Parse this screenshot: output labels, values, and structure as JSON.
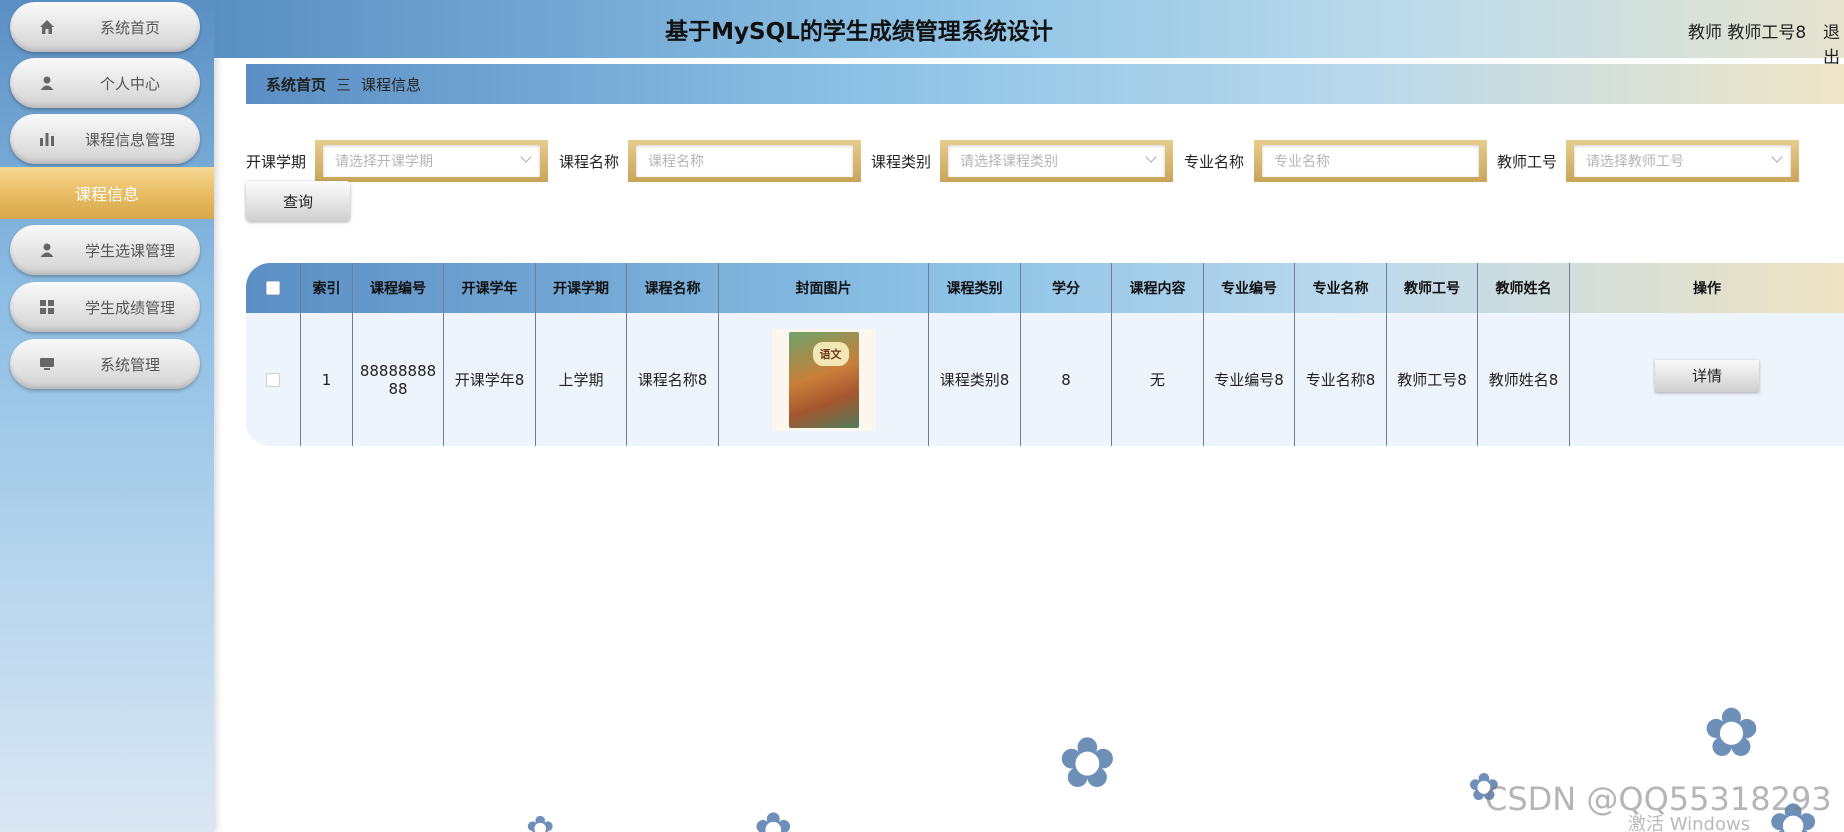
{
  "header": {
    "title": "基于MySQL的学生成绩管理系统设计",
    "user": "教师 教师工号8",
    "logout": "退出"
  },
  "sidebar": {
    "items": [
      {
        "label": "系统首页",
        "icon": "home-icon"
      },
      {
        "label": "个人中心",
        "icon": "user-icon"
      },
      {
        "label": "课程信息管理",
        "icon": "bar-chart-icon"
      },
      {
        "label": "学生选课管理",
        "icon": "user-icon"
      },
      {
        "label": "学生成绩管理",
        "icon": "grid-icon"
      },
      {
        "label": "系统管理",
        "icon": "monitor-icon"
      }
    ],
    "active_sub": "课程信息"
  },
  "breadcrumb": {
    "home": "系统首页",
    "separator": "三",
    "current": "课程信息"
  },
  "filters": [
    {
      "label": "开课学期",
      "placeholder": "请选择开课学期",
      "type": "select"
    },
    {
      "label": "课程名称",
      "placeholder": "课程名称",
      "type": "input"
    },
    {
      "label": "课程类别",
      "placeholder": "请选择课程类别",
      "type": "select"
    },
    {
      "label": "专业名称",
      "placeholder": "专业名称",
      "type": "input"
    },
    {
      "label": "教师工号",
      "placeholder": "请选择教师工号",
      "type": "select"
    }
  ],
  "search_button": "查询",
  "table": {
    "columns": [
      "索引",
      "课程编号",
      "开课学年",
      "开课学期",
      "课程名称",
      "封面图片",
      "课程类别",
      "学分",
      "课程内容",
      "专业编号",
      "专业名称",
      "教师工号",
      "教师姓名",
      "操作"
    ],
    "rows": [
      {
        "index": "1",
        "course_no": "88888888 88",
        "year": "开课学年8",
        "semester": "上学期",
        "name": "课程名称8",
        "cover_text": "语文",
        "category": "课程类别8",
        "credit": "8",
        "content": "无",
        "major_no": "专业编号8",
        "major_name": "专业名称8",
        "teacher_no": "教师工号8",
        "teacher_name": "教师姓名8",
        "action": "详情"
      }
    ]
  },
  "watermark": "CSDN @QQ55318293",
  "os_notice": "激活 Windows"
}
